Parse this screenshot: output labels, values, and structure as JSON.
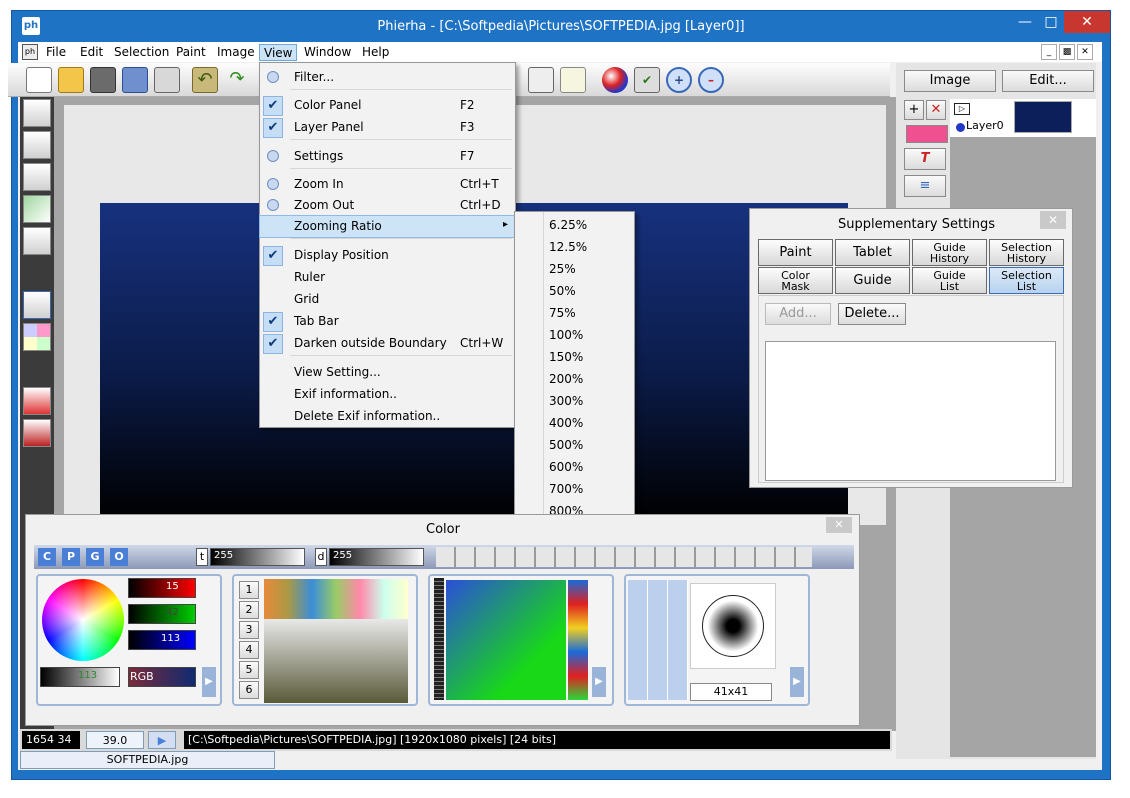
{
  "window": {
    "title": "Phierha - [C:\\Softpedia\\Pictures\\SOFTPEDIA.jpg [Layer0]]",
    "accent": "#1f73c4"
  },
  "menubar": {
    "items": [
      "File",
      "Edit",
      "Selection",
      "Paint",
      "Image",
      "View",
      "Window",
      "Help"
    ]
  },
  "view_menu": {
    "items": [
      {
        "label": "Filter...",
        "shortcut": "",
        "checked": false
      },
      {
        "label": "Color Panel",
        "shortcut": "F2",
        "checked": true
      },
      {
        "label": "Layer Panel",
        "shortcut": "F3",
        "checked": true
      },
      {
        "label": "Settings",
        "shortcut": "F7",
        "checked": false
      },
      {
        "label": "Zoom In",
        "shortcut": "Ctrl+T",
        "checked": false
      },
      {
        "label": "Zoom Out",
        "shortcut": "Ctrl+D",
        "checked": false
      },
      {
        "label": "Zooming Ratio",
        "shortcut": "",
        "checked": false
      },
      {
        "label": "Display Position",
        "shortcut": "",
        "checked": true
      },
      {
        "label": "Ruler",
        "shortcut": "",
        "checked": false
      },
      {
        "label": "Grid",
        "shortcut": "",
        "checked": false
      },
      {
        "label": "Tab Bar",
        "shortcut": "",
        "checked": true
      },
      {
        "label": "Darken outside Boundary",
        "shortcut": "Ctrl+W",
        "checked": true
      },
      {
        "label": "View Setting...",
        "shortcut": "",
        "checked": false
      },
      {
        "label": "Exif information..",
        "shortcut": "",
        "checked": false
      },
      {
        "label": "Delete Exif information..",
        "shortcut": "",
        "checked": false
      }
    ]
  },
  "zoom_menu": {
    "items": [
      "6.25%",
      "12.5%",
      "25%",
      "50%",
      "75%",
      "100%",
      "150%",
      "200%",
      "300%",
      "400%",
      "500%",
      "600%",
      "700%",
      "800%"
    ]
  },
  "layer_panel": {
    "image_button": "Image",
    "edit_button": "Edit...",
    "layer_name": "Layer0"
  },
  "supplementary": {
    "title": "Supplementary Settings",
    "tabs_row1": [
      "Paint",
      "Tablet",
      "Guide\nHistory",
      "Selection\nHistory"
    ],
    "tabs_row2": [
      "Color\nMask",
      "Guide",
      "Guide\nList",
      "Selection\nList"
    ],
    "add_button": "Add...",
    "delete_button": "Delete..."
  },
  "color_panel": {
    "title": "Color",
    "mode_buttons": [
      "C",
      "P",
      "G",
      "O"
    ],
    "t_label": "t",
    "t_value": "255",
    "d_label": "d",
    "d_value": "255",
    "red": "15",
    "green": "42",
    "blue": "113",
    "gray_value": "113",
    "mode_label": "RGB",
    "palette_tabs": [
      "1",
      "2",
      "3",
      "4",
      "5",
      "6"
    ],
    "brush_size": "41x41"
  },
  "status": {
    "position": "1654  34",
    "zoom": "39.0",
    "file_info": "[C:\\Softpedia\\Pictures\\SOFTPEDIA.jpg] [1920x1080 pixels] [24 bits]"
  },
  "document_tab": "SOFTPEDIA.jpg"
}
